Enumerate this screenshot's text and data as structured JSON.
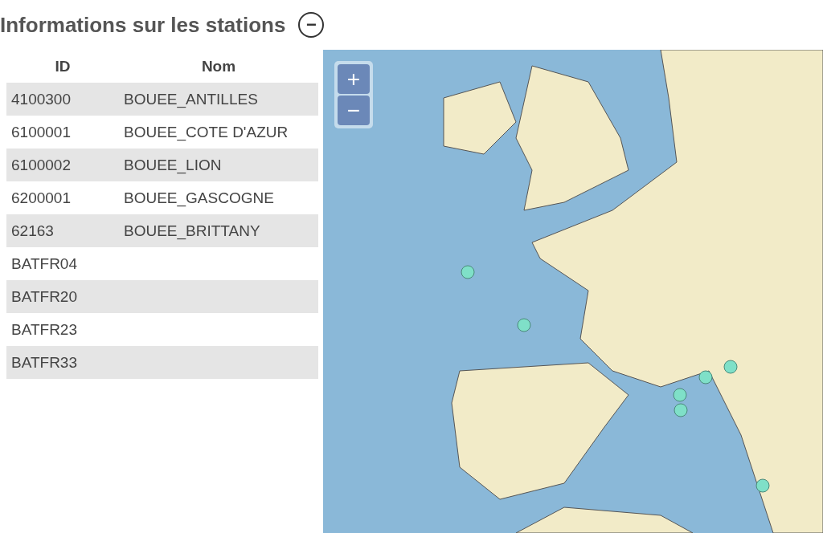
{
  "section": {
    "title": "Informations sur les stations",
    "collapse_icon": "−"
  },
  "table": {
    "columns": [
      "ID",
      "Nom"
    ],
    "rows": [
      {
        "id": "4100300",
        "name": "BOUEE_ANTILLES"
      },
      {
        "id": "6100001",
        "name": "BOUEE_COTE D'AZUR"
      },
      {
        "id": "6100002",
        "name": "BOUEE_LION"
      },
      {
        "id": "6200001",
        "name": "BOUEE_GASCOGNE"
      },
      {
        "id": "62163",
        "name": "BOUEE_BRITTANY"
      },
      {
        "id": "BATFR04"
      },
      {
        "id": "BATFR20"
      },
      {
        "id": "BATFR23"
      },
      {
        "id": "BATFR33"
      }
    ]
  },
  "map": {
    "zoom_in": "+",
    "zoom_out": "−"
  }
}
